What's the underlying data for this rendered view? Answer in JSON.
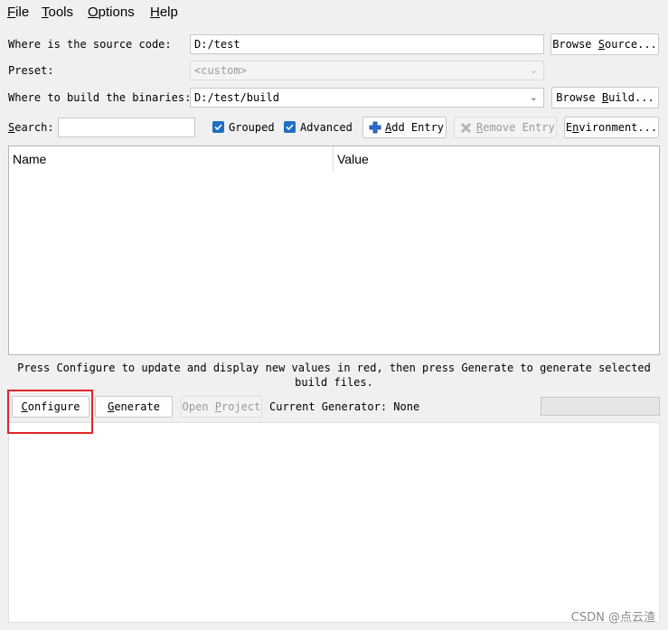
{
  "menu": {
    "file": {
      "u": "F",
      "rest": "ile"
    },
    "tools": {
      "u": "T",
      "rest": "ools"
    },
    "options": {
      "u": "O",
      "rest": "ptions"
    },
    "help": {
      "u": "H",
      "rest": "elp"
    }
  },
  "source": {
    "label": "Where is the source code:",
    "value": "D:/test",
    "browse_pre": "Browse ",
    "browse_u": "S",
    "browse_post": "ource..."
  },
  "preset": {
    "label": "Preset:",
    "value": "<custom>"
  },
  "build": {
    "label": "Where to build the binaries:",
    "value": "D:/test/build",
    "browse_pre": "Browse ",
    "browse_u": "B",
    "browse_post": "uild..."
  },
  "search": {
    "label_u": "S",
    "label_rest": "earch:",
    "value": ""
  },
  "toggles": {
    "grouped": "Grouped",
    "advanced": "Advanced",
    "grouped_checked": true,
    "advanced_checked": true
  },
  "entries": {
    "add_u": "A",
    "add_rest": "dd Entry",
    "remove_u": "R",
    "remove_rest": "emove Entry"
  },
  "environment": {
    "u": "n",
    "pre": "E",
    "rest": "vironment..."
  },
  "table": {
    "columns": [
      "Name",
      "Value"
    ],
    "rows": []
  },
  "hint_text": "Press Configure to update and display new values in red, then press Generate to generate selected build files.",
  "actions": {
    "configure_u": "C",
    "configure_rest": "onfigure",
    "generate_u": "G",
    "generate_rest": "enerate",
    "open_project_pre": "Open ",
    "open_project_u": "P",
    "open_project_post": "roject"
  },
  "generator": {
    "text": "Current Generator: None"
  },
  "progress": 0,
  "watermark": "CSDN @点云渣",
  "colors": {
    "accent": "#1f6fc2",
    "highlight": "#e0262c"
  }
}
